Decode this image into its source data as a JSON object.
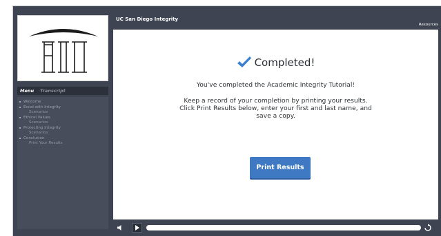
{
  "header": {
    "course_title": "UC San Diego Integrity",
    "resources_label": "Resources"
  },
  "logo": {
    "text": "AIO"
  },
  "sidebar": {
    "tabs": [
      {
        "label": "Menu",
        "active": true
      },
      {
        "label": "Transcript",
        "active": false
      }
    ],
    "items": [
      {
        "label": "Welcome",
        "sub": ""
      },
      {
        "label": "Excel with Integrity",
        "sub": "Scenarios"
      },
      {
        "label": "Ethical Values",
        "sub": "Scenarios"
      },
      {
        "label": "Protecting Integrity",
        "sub": "Scenarios"
      },
      {
        "label": "Conclusion",
        "sub": "Print Your Results"
      }
    ]
  },
  "main": {
    "completed_title": "Completed!",
    "message": "You've completed the Academic Integrity Tutorial!",
    "instructions_line1": "Keep a record of your completion by printing your results.",
    "instructions_line2": "Click Print Results below, enter your first and last name, and",
    "instructions_line3": "save a copy.",
    "print_button_label": "Print Results"
  },
  "player": {
    "progress": 1.0
  },
  "icons": {
    "check": "checkmark-icon",
    "volume": "volume-icon",
    "play": "play-icon",
    "replay": "replay-icon"
  },
  "colors": {
    "frame": "#3e4452",
    "accent": "#3f79c4",
    "check": "#3b7fd0"
  }
}
